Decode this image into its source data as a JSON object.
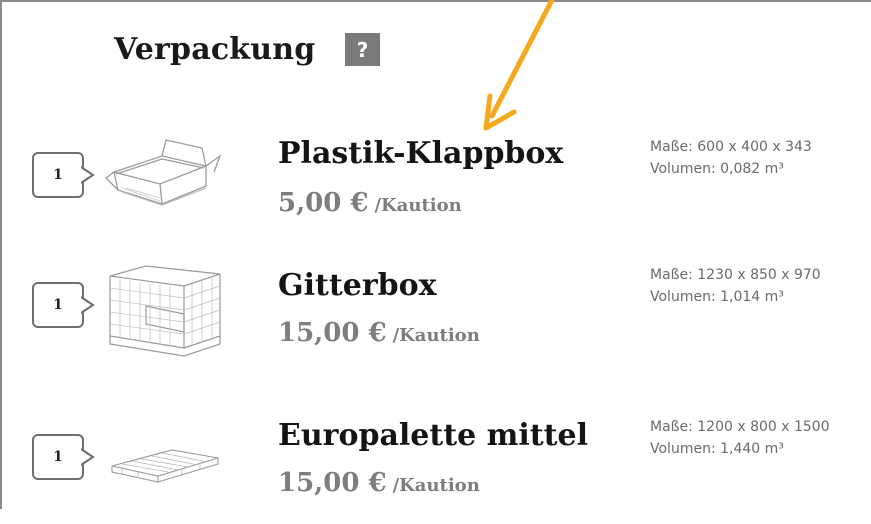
{
  "section": {
    "title": "Verpackung",
    "help_label": "?"
  },
  "items": [
    {
      "quantity": "1",
      "name": "Plastik-Klappbox",
      "price": "5,00 €",
      "price_unit": "/Kaution",
      "dimensions": "Maße: 600 x 400 x 343",
      "volume": "Volumen: 0,082 m³",
      "icon": "folding-box-icon"
    },
    {
      "quantity": "1",
      "name": "Gitterbox",
      "price": "15,00 €",
      "price_unit": "/Kaution",
      "dimensions": "Maße: 1230 x 850 x 970",
      "volume": "Volumen: 1,014 m³",
      "icon": "mesh-box-icon"
    },
    {
      "quantity": "1",
      "name": "Europalette mittel",
      "price": "15,00 €",
      "price_unit": "/Kaution",
      "dimensions": "Maße: 1200 x 800 x 1500",
      "volume": "Volumen: 1,440 m³",
      "icon": "pallet-icon"
    }
  ],
  "colors": {
    "annotation_arrow": "#f5a81c",
    "help_badge": "#7a7a7a",
    "price_text": "#7d7d7d"
  }
}
